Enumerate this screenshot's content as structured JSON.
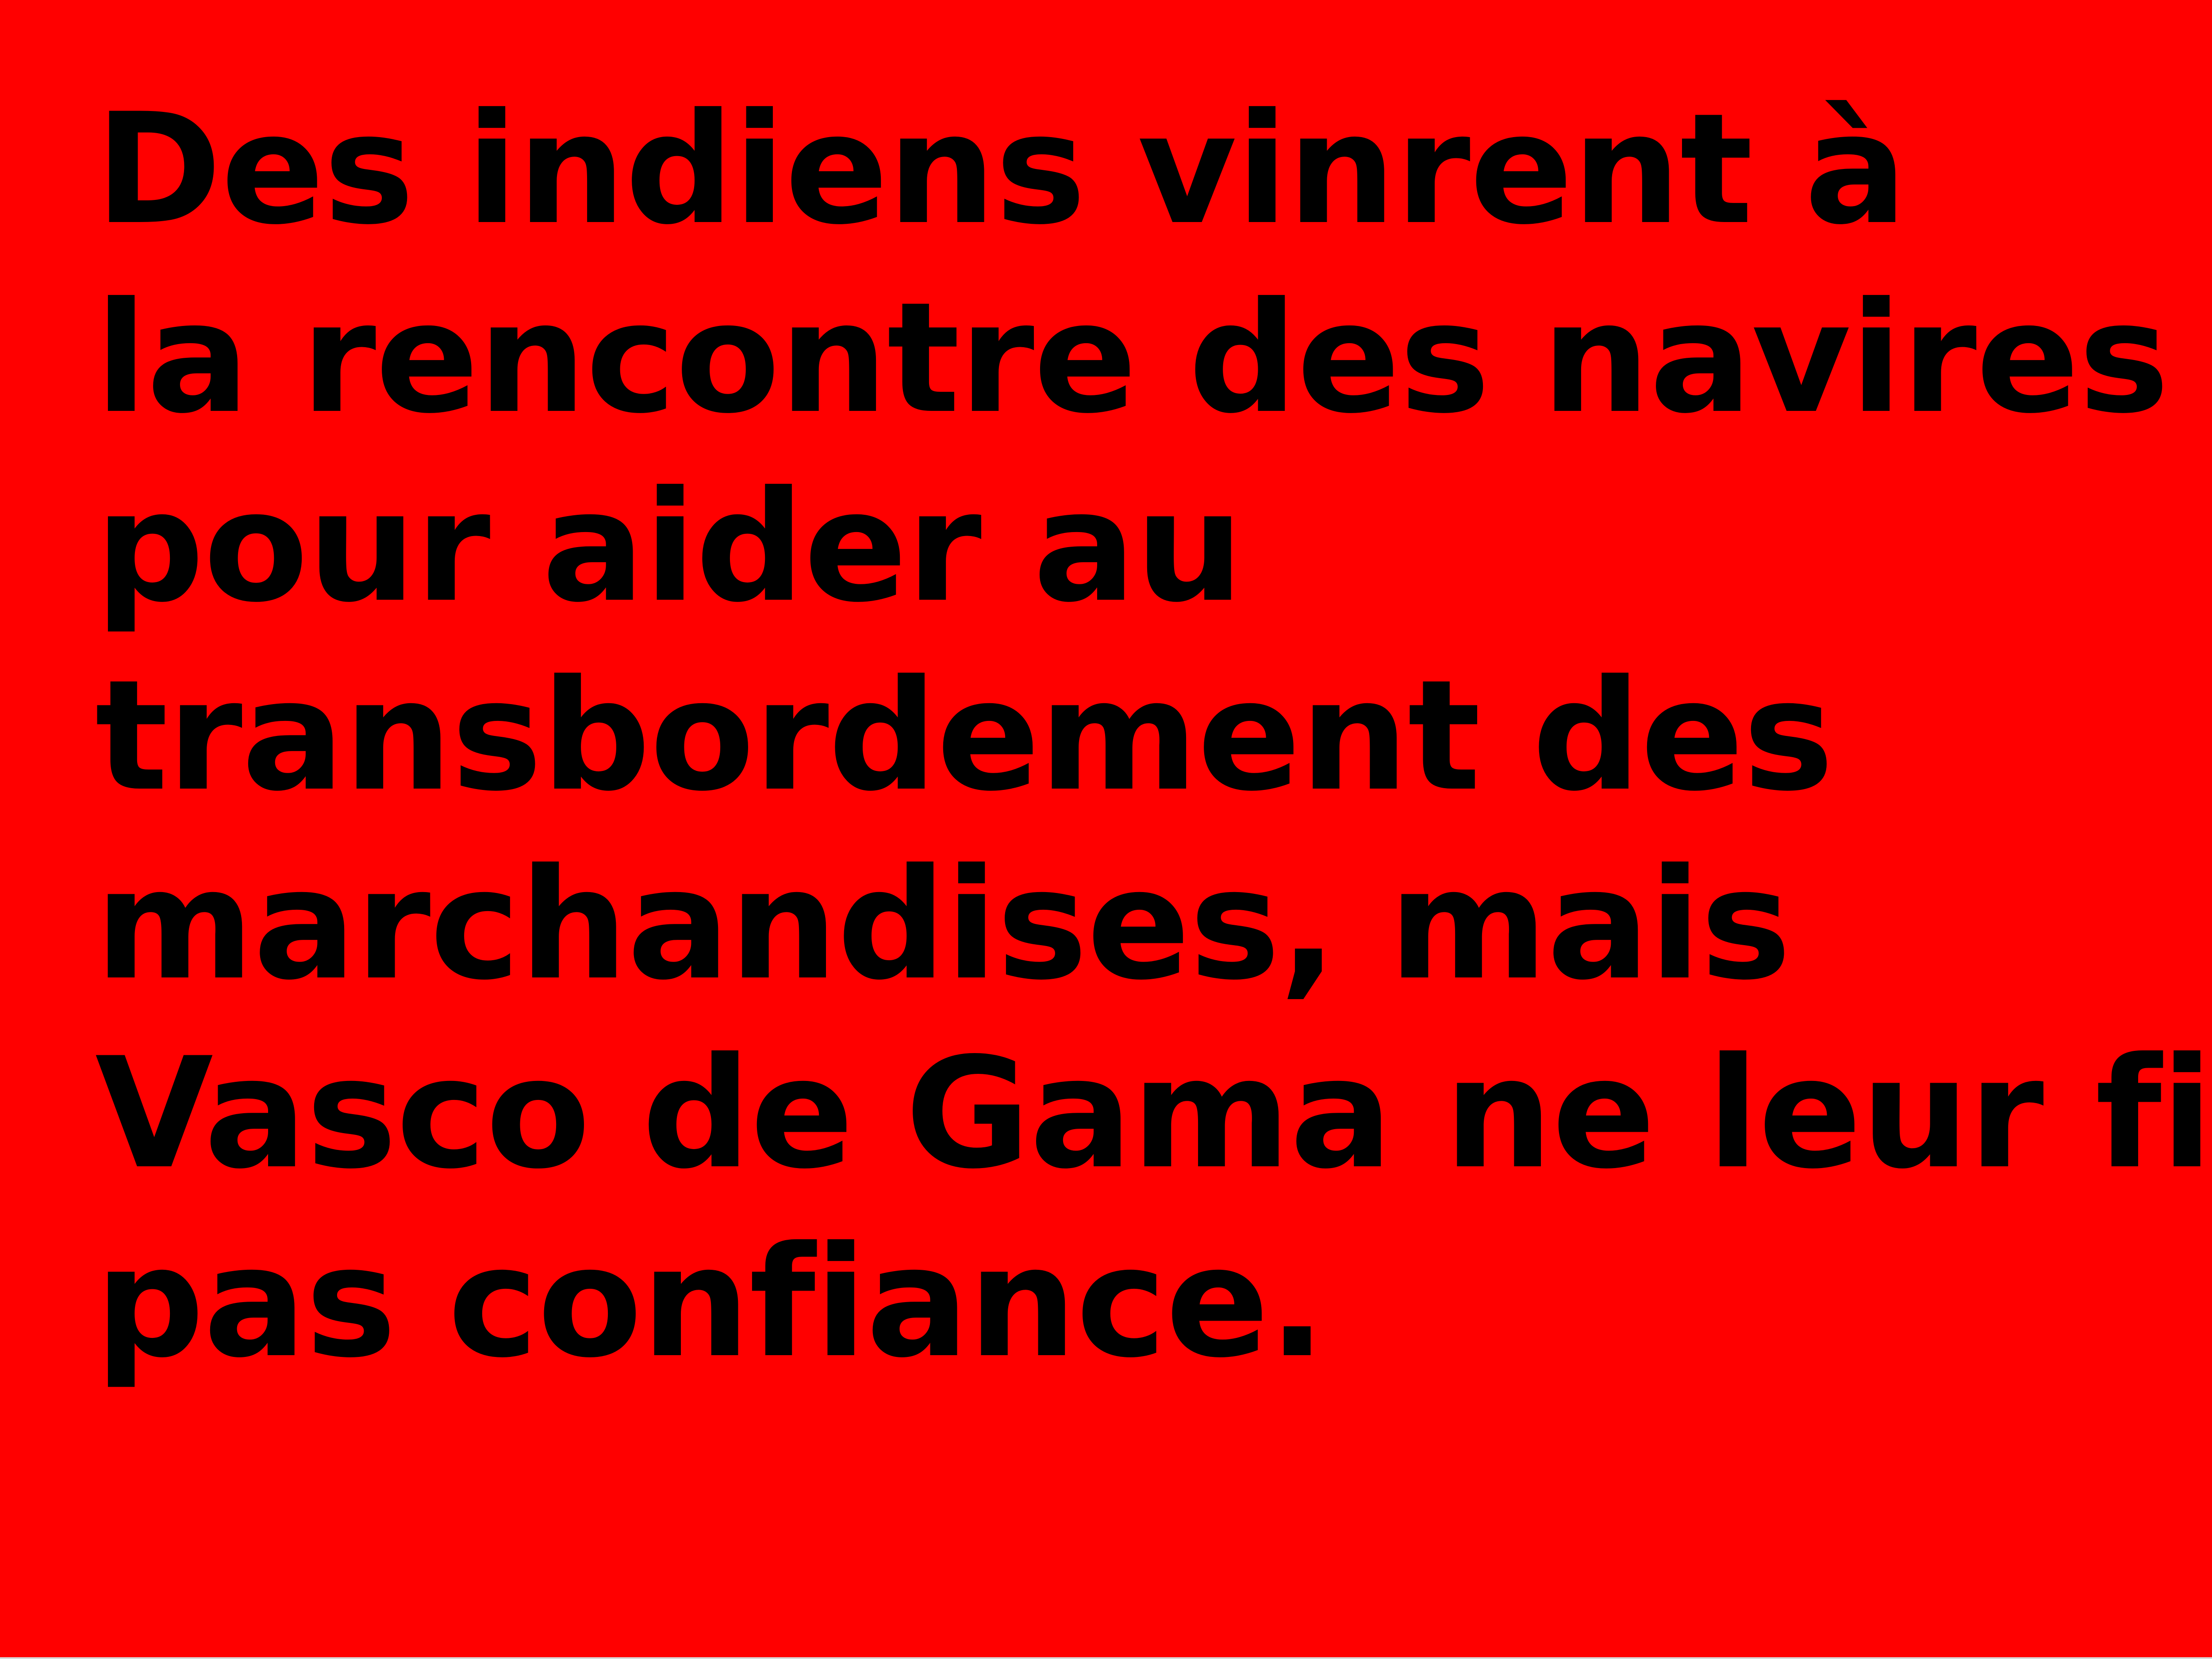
{
  "colors": {
    "background": "#ff0000",
    "text": "#000000"
  },
  "text_lines": [
    "Des indiens vinrent à",
    "la rencontre des navires",
    "pour aider au",
    "transbordement des",
    "marchandises, mais",
    "Vasco de Gama ne leur fit",
    "pas confiance."
  ]
}
